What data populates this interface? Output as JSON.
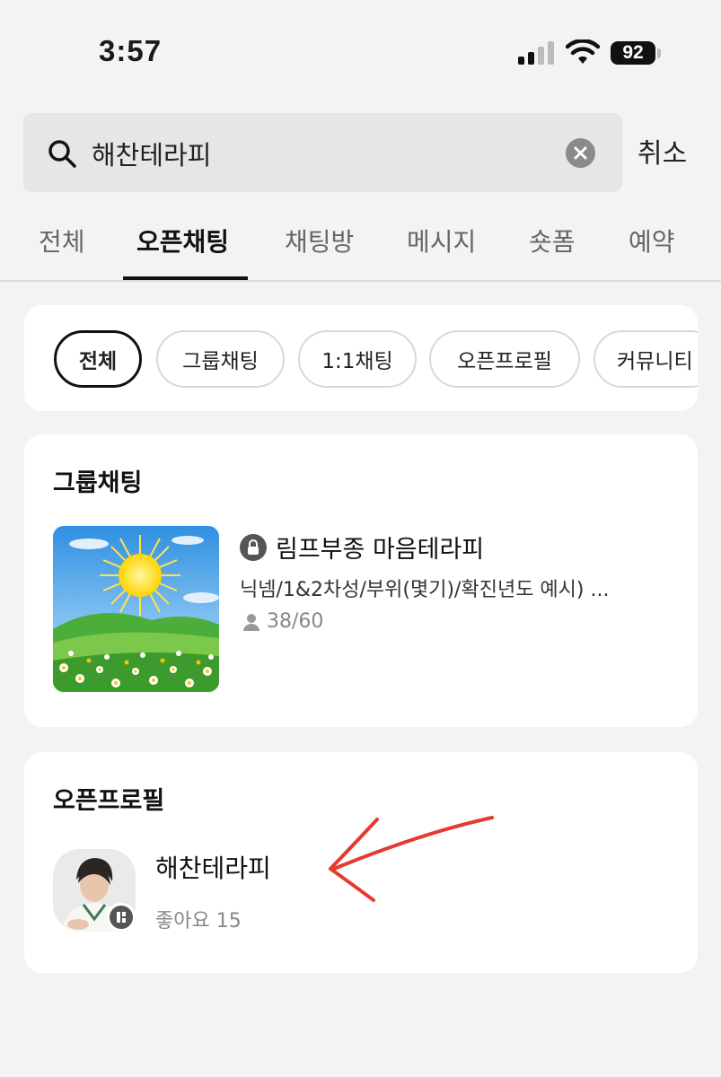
{
  "status_bar": {
    "time": "3:57",
    "battery": "92"
  },
  "search": {
    "query": "해찬테라피",
    "cancel_label": "취소"
  },
  "tabs": [
    {
      "label": "전체",
      "active": false
    },
    {
      "label": "오픈채팅",
      "active": true
    },
    {
      "label": "채팅방",
      "active": false
    },
    {
      "label": "메시지",
      "active": false
    },
    {
      "label": "숏폼",
      "active": false
    },
    {
      "label": "예약",
      "active": false
    }
  ],
  "filter_chips": [
    {
      "label": "전체",
      "active": true
    },
    {
      "label": "그룹채팅",
      "active": false
    },
    {
      "label": "1:1채팅",
      "active": false
    },
    {
      "label": "오픈프로필",
      "active": false
    },
    {
      "label": "커뮤니티",
      "active": false
    }
  ],
  "group_chat": {
    "section_title": "그룹채팅",
    "room": {
      "name": "림프부종 마음테라피",
      "description": "닉넴/1&2차성/부위(몇기)/확진년도 예시) ...",
      "members": "38/60",
      "locked": true
    }
  },
  "open_profile": {
    "section_title": "오픈프로필",
    "profile": {
      "name": "해찬테라피",
      "likes": "좋아요 15"
    }
  },
  "colors": {
    "annotation_arrow": "#e53a2f",
    "background": "#f3f3f3"
  }
}
